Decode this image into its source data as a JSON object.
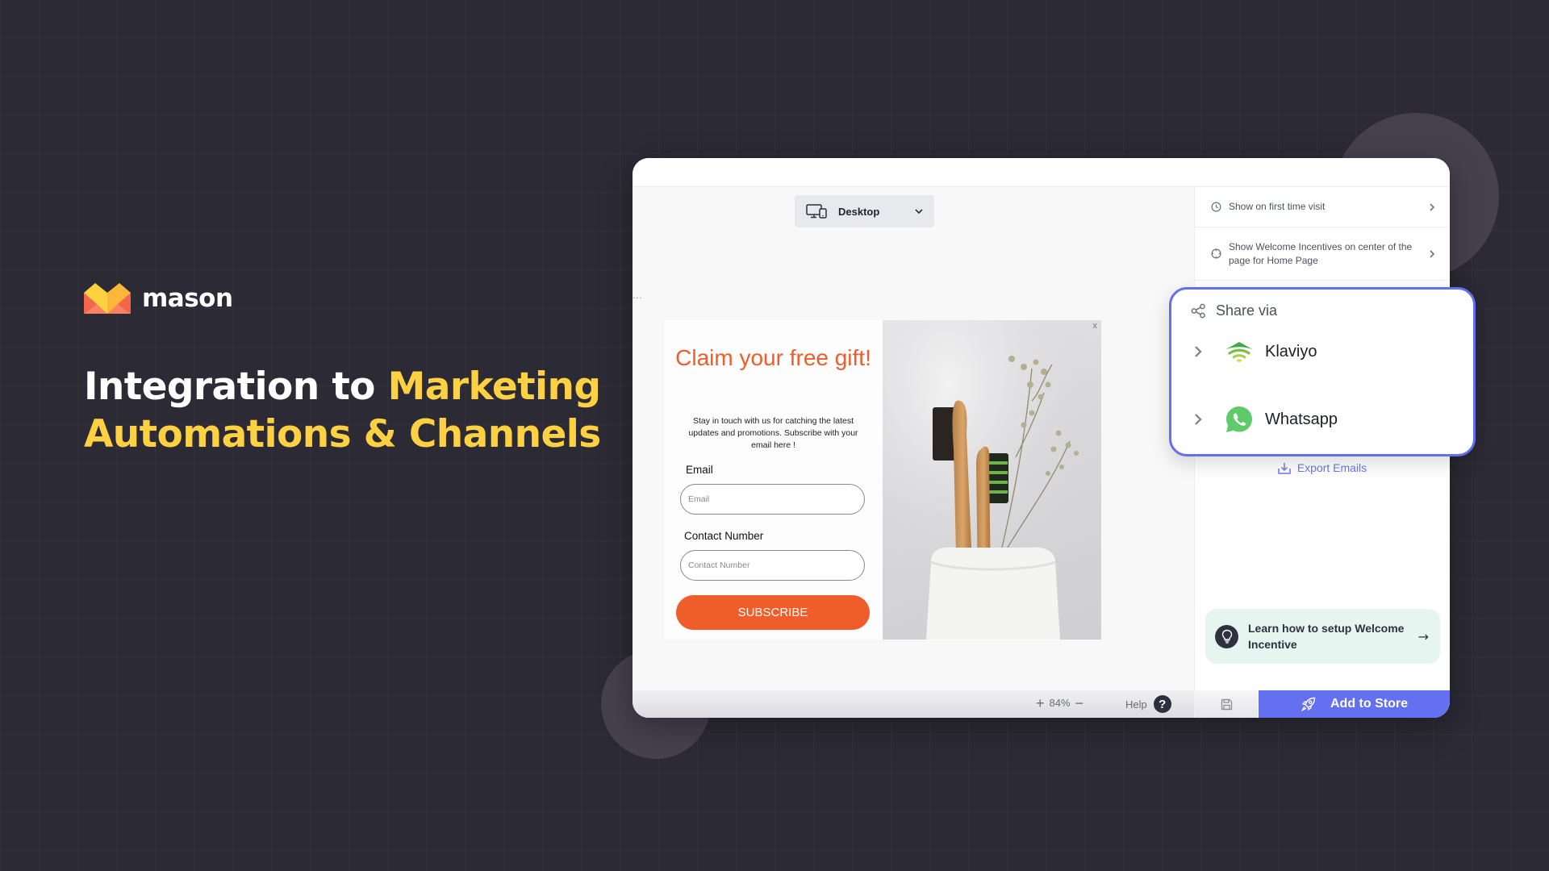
{
  "brand": {
    "name": "mason"
  },
  "hero": {
    "line1_plain": "Integration to ",
    "line1_highlight": "Marketing",
    "line2_highlight": "Automations & Channels"
  },
  "colors": {
    "background": "#2c2a35",
    "highlight": "#fdd142",
    "accent": "#6470f0",
    "popup_orange": "#ef5e2a"
  },
  "editor": {
    "device_select": {
      "icon": "devices-icon",
      "value": "Desktop"
    },
    "truncated_label": "...",
    "popup_preview": {
      "title": "Claim your free gift!",
      "description": "Stay in touch with us for catching the latest updates and promotions. Subscribe with your email here !",
      "fields": [
        {
          "label": "Email",
          "placeholder": "Email"
        },
        {
          "label": "Contact Number",
          "placeholder": "Contact Number"
        }
      ],
      "submit_label": "SUBSCRIBE",
      "close_label": "x",
      "image_alt": "Bamboo toothbrushes in a white towel holder with dried flowers"
    },
    "zoom": {
      "zoom_in": "+",
      "value": "84%",
      "zoom_out": "−"
    },
    "help": {
      "label": "Help",
      "icon": "?"
    }
  },
  "settings_panel": {
    "rows": [
      {
        "icon": "clock-icon",
        "text": "Show on first time visit"
      },
      {
        "icon": "crosshair-icon",
        "text": "Show Welcome Incentives on center of the page for Home Page"
      }
    ],
    "export_label": "Export Emails",
    "learn": {
      "text": "Learn how to setup Welcome Incentive",
      "arrow": "→"
    },
    "add_to_store_label": "Add to Store"
  },
  "share_popup": {
    "title": "Share via",
    "items": [
      {
        "name": "Klaviyo",
        "icon": "klaviyo-icon"
      },
      {
        "name": "Whatsapp",
        "icon": "whatsapp-icon"
      }
    ]
  }
}
